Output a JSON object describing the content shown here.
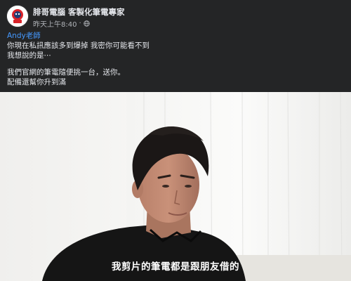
{
  "post": {
    "page_name": "腓哥電腦 客製化筆電專家",
    "timestamp": "昨天上午8:40",
    "audience_icon": "globe-icon",
    "mention": "Andy老師",
    "message_lines": [
      "你現在私訊應該多到爆掉 我密你可能看不到",
      "我想說的是⋯",
      "我們官網的筆電隨便挑一台，送你。",
      "配備還幫你升到滿"
    ]
  },
  "video": {
    "subtitle": "我剪片的筆電都是跟朋友借的"
  },
  "colors": {
    "background": "#242526",
    "primary_text": "#e4e6eb",
    "secondary_text": "#b0b3b8",
    "mention": "#4599ff"
  }
}
